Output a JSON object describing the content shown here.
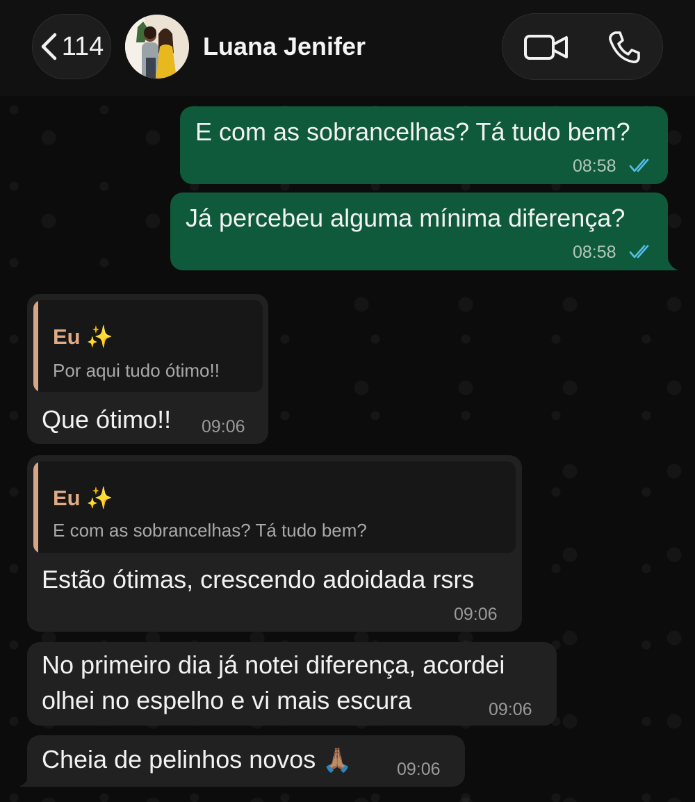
{
  "header": {
    "back_count": "114",
    "contact_name": "Luana Jenifer"
  },
  "colors": {
    "outgoing_bubble": "#0e5a3b",
    "incoming_bubble": "#212121",
    "read_ticks": "#53bdeb",
    "quote_author": "#e0aa87"
  },
  "icons": [
    "chevron-left-icon",
    "video-camera-icon",
    "phone-icon",
    "double-check-icon",
    "sparkles-emoji",
    "folded-hands-emoji"
  ],
  "messages": [
    {
      "direction": "outgoing",
      "text": "E com as sobrancelhas? Tá tudo bem?",
      "time": "08:58",
      "status": "read"
    },
    {
      "direction": "outgoing",
      "text": "Já percebeu alguma mínima diferença?",
      "time": "08:58",
      "status": "read"
    },
    {
      "direction": "incoming",
      "quote": {
        "author": "Eu",
        "author_emoji": "✨",
        "text": "Por aqui tudo ótimo!!"
      },
      "text": "Que ótimo!!",
      "time": "09:06"
    },
    {
      "direction": "incoming",
      "quote": {
        "author": "Eu",
        "author_emoji": "✨",
        "text": "E com as sobrancelhas? Tá tudo bem?"
      },
      "text": "Estão ótimas, crescendo adoidada rsrs",
      "time": "09:06"
    },
    {
      "direction": "incoming",
      "text_lines": [
        "No primeiro dia já notei diferença, acordei",
        "olhei no espelho e vi mais escura"
      ],
      "time": "09:06"
    },
    {
      "direction": "incoming",
      "text": "Cheia de pelinhos novos",
      "emoji": "🙏🏽",
      "time": "09:06"
    }
  ]
}
